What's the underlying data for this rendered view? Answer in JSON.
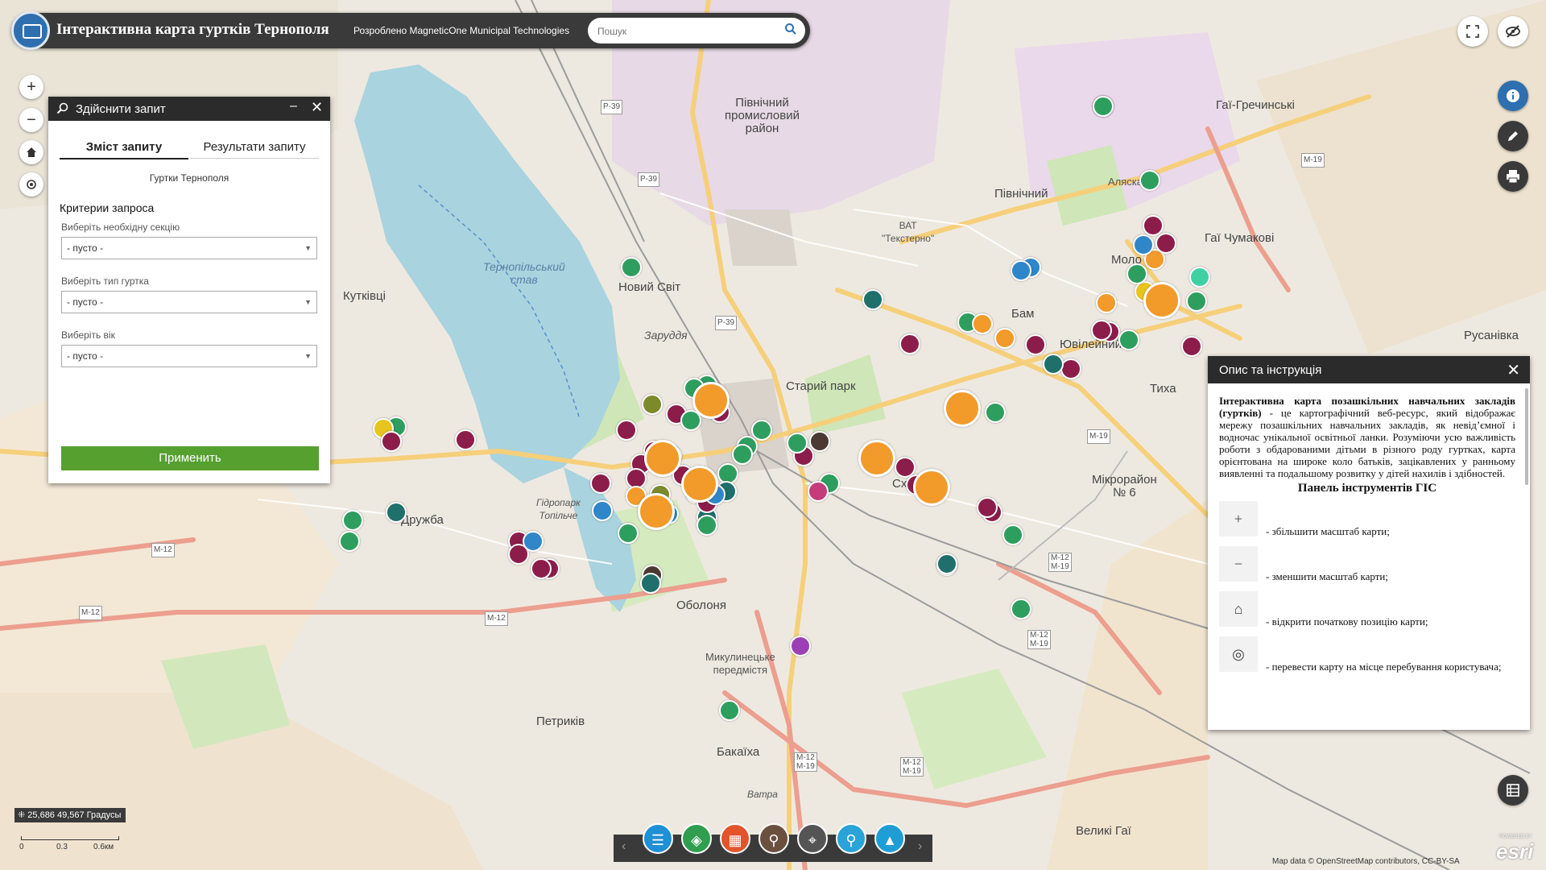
{
  "header": {
    "title": "Інтерактивна карта гуртків Тернополя",
    "subtitle": "Розроблено MagneticOne Municipal Technologies",
    "search_placeholder": "Пошук"
  },
  "map_labels": [
    {
      "text": "Північний\nпромисловий\nрайон",
      "kind": "big"
    },
    {
      "text": "Північний",
      "kind": "big"
    },
    {
      "text": "ВАТ\n\"Текстерно\"",
      "kind": "normal"
    },
    {
      "text": "Тернопільський\nстав",
      "kind": "water"
    },
    {
      "text": "Новий Світ",
      "kind": "big"
    },
    {
      "text": "Кутківці",
      "kind": "big"
    },
    {
      "text": "Заруддя",
      "kind": "normal"
    },
    {
      "text": "Старий парк",
      "kind": "big"
    },
    {
      "text": "Бам",
      "kind": "big"
    },
    {
      "text": "Ювілейний",
      "kind": "big"
    },
    {
      "text": "Дружба",
      "kind": "big"
    },
    {
      "text": "Оболоня",
      "kind": "big"
    },
    {
      "text": "Микулинецьке\nпередмістя",
      "kind": "normal"
    },
    {
      "text": "Мікрорайон\n№ 6",
      "kind": "big"
    },
    {
      "text": "Петриків",
      "kind": "big"
    },
    {
      "text": "Бакаїха",
      "kind": "big"
    },
    {
      "text": "Великі Гаї",
      "kind": "big"
    },
    {
      "text": "Гаї Чумакові",
      "kind": "big"
    },
    {
      "text": "Гаї-Гречинські",
      "kind": "big"
    },
    {
      "text": "Русанівка",
      "kind": "big"
    },
    {
      "text": "Аляска",
      "kind": "normal"
    },
    {
      "text": "Моло",
      "kind": "big"
    },
    {
      "text": "Схі",
      "kind": "big"
    },
    {
      "text": "Тиха",
      "kind": "big"
    },
    {
      "text": "Ватра",
      "kind": "normal"
    },
    {
      "text": "Гідропарк\nТопільче",
      "kind": "normal"
    }
  ],
  "road_labels": [
    "P-39",
    "P-39",
    "P-39",
    "M-19",
    "M-19",
    "M-12",
    "M-12",
    "M-12\nM-19",
    "M-12\nM-19",
    "M-12\nM-19",
    "M-12\nM-19",
    "M-12"
  ],
  "marker_colors": {
    "green": "#2e9e5e",
    "maroon": "#8c1d4a",
    "orange": "#f29a2a",
    "blue": "#2f86c8",
    "olive": "#7c8a2c",
    "dark": "#4b3a33",
    "teal": "#1f6f6b",
    "pink": "#c43c7a",
    "yellow": "#e8c41e",
    "mint": "#3fd1a4",
    "purple": "#9b3fb5"
  },
  "controls": {
    "zoom_in": "+",
    "zoom_out": "−",
    "home_icon": "home-icon",
    "locate_icon": "locate-icon"
  },
  "query_panel": {
    "title": "Здійснити запит",
    "tabs": [
      "Зміст запиту",
      "Результати запиту"
    ],
    "layer": "Гуртки Тернополя",
    "criteria_title": "Критерии запроса",
    "fields": [
      {
        "label": "Виберіть необхідну секцію",
        "value": "- пусто -"
      },
      {
        "label": "Виберіть тип гуртка",
        "value": "- пусто -"
      },
      {
        "label": "Виберіть вік",
        "value": "- пусто -"
      }
    ],
    "apply": "Применить"
  },
  "desc_panel": {
    "title": "Опис та інструкція",
    "intro_bold": "Інтерактивна карта позашкільних навчальних закладів (гуртків)",
    "intro_rest": " - це картографічний веб-ресурс, який відображає мережу позашкільних навчальних закладів, як невід’ємної і водночас унікальної освітньої ланки. Розуміючи усю важливість роботи з обдарованими дітьми в різного роду гуртках, карта орієнтована на широке коло батьків, зацікавлених у ранньому виявленні та подальшому розвитку у дітей нахилів і здібностей.",
    "heading": "Панель інструментів ГІС",
    "tools": [
      {
        "icon": "+",
        "text": "- збільшити масштаб карти;"
      },
      {
        "icon": "−",
        "text": "- зменшити масштаб карти;"
      },
      {
        "icon": "⌂",
        "text": "- відкрити початкову позицію карти;"
      },
      {
        "icon": "◎",
        "text": "- перевести карту на місце перебування користувача;"
      }
    ]
  },
  "status": {
    "coords": "25,686 49,567 Градусы",
    "scale_ticks": [
      "0",
      "0.3",
      "0.6км"
    ],
    "attribution": "Map data © OpenStreetMap contributors, CC-BY-SA",
    "esri": "esri",
    "powered": "POWERED BY"
  },
  "toolbar": {
    "colors": [
      "#1f8fd6",
      "#2f9e4e",
      "#e3542a",
      "#6b4f3f",
      "#555",
      "#29a3d8",
      "#1f9ed6"
    ]
  }
}
